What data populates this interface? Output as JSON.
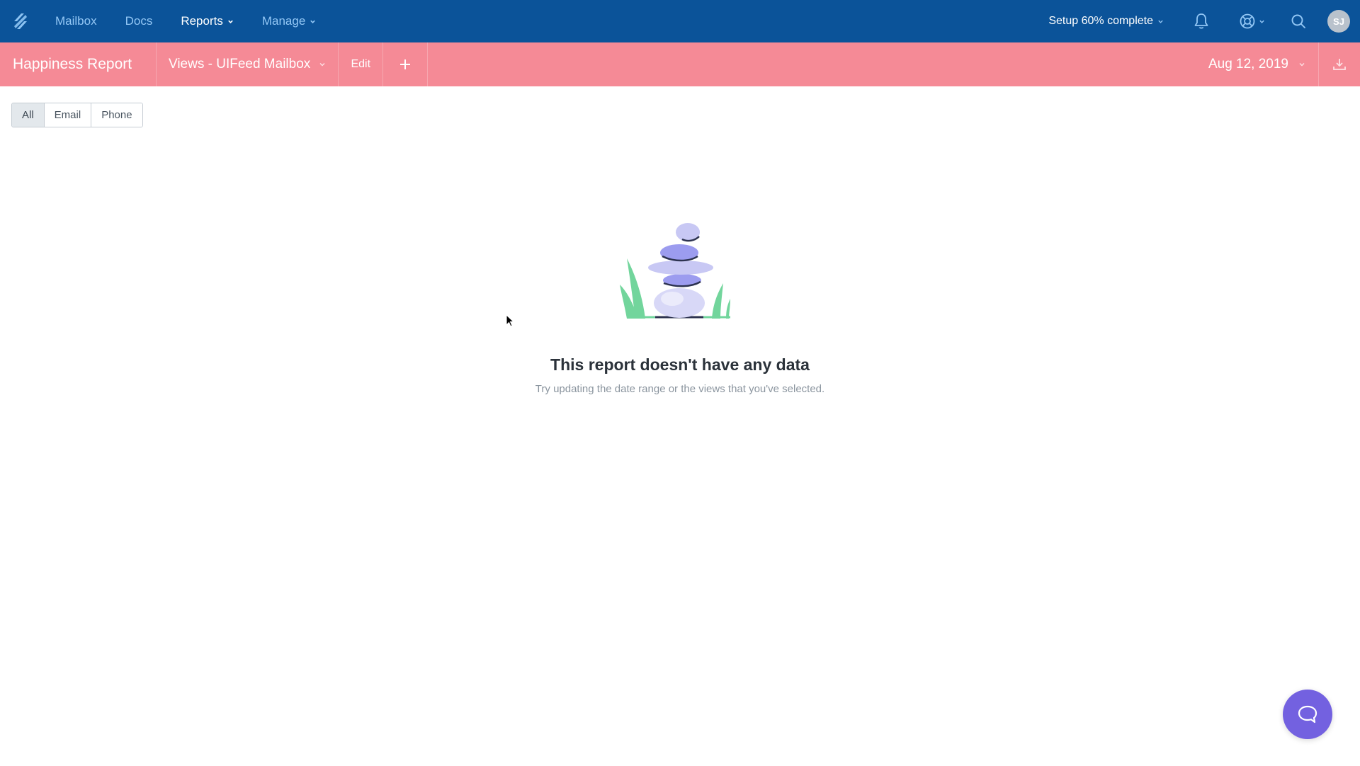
{
  "topnav": {
    "logo": "helpscout-logo-icon",
    "items": [
      {
        "label": "Mailbox",
        "dropdown": false,
        "active": false
      },
      {
        "label": "Docs",
        "dropdown": false,
        "active": false
      },
      {
        "label": "Reports",
        "dropdown": true,
        "active": true
      },
      {
        "label": "Manage",
        "dropdown": true,
        "active": false
      }
    ],
    "setup_label": "Setup 60% complete",
    "setup_progress_percent": 60,
    "avatar_initials": "SJ",
    "icons": [
      "bell-icon",
      "help-lifebuoy-icon",
      "search-icon"
    ]
  },
  "subbar": {
    "report_title": "Happiness Report",
    "views_label": "Views - UIFeed Mailbox",
    "edit_label": "Edit",
    "add_icon": "plus-icon",
    "date_label": "Aug 12, 2019",
    "download_icon": "download-icon"
  },
  "filters": {
    "options": [
      "All",
      "Email",
      "Phone"
    ],
    "selected": "All"
  },
  "empty_state": {
    "illustration": "stacked-stones-illustration",
    "title": "This report doesn't have any data",
    "subtitle": "Try updating the date range or the views that you've selected."
  },
  "colors": {
    "topnav_bg": "#0b5399",
    "subbar_bg": "#f58a96",
    "chat_button": "#7361e0",
    "stone_purple": "#9c9cef",
    "plant_green": "#6fd49a"
  },
  "chat": {
    "icon": "chat-bubble-icon"
  }
}
